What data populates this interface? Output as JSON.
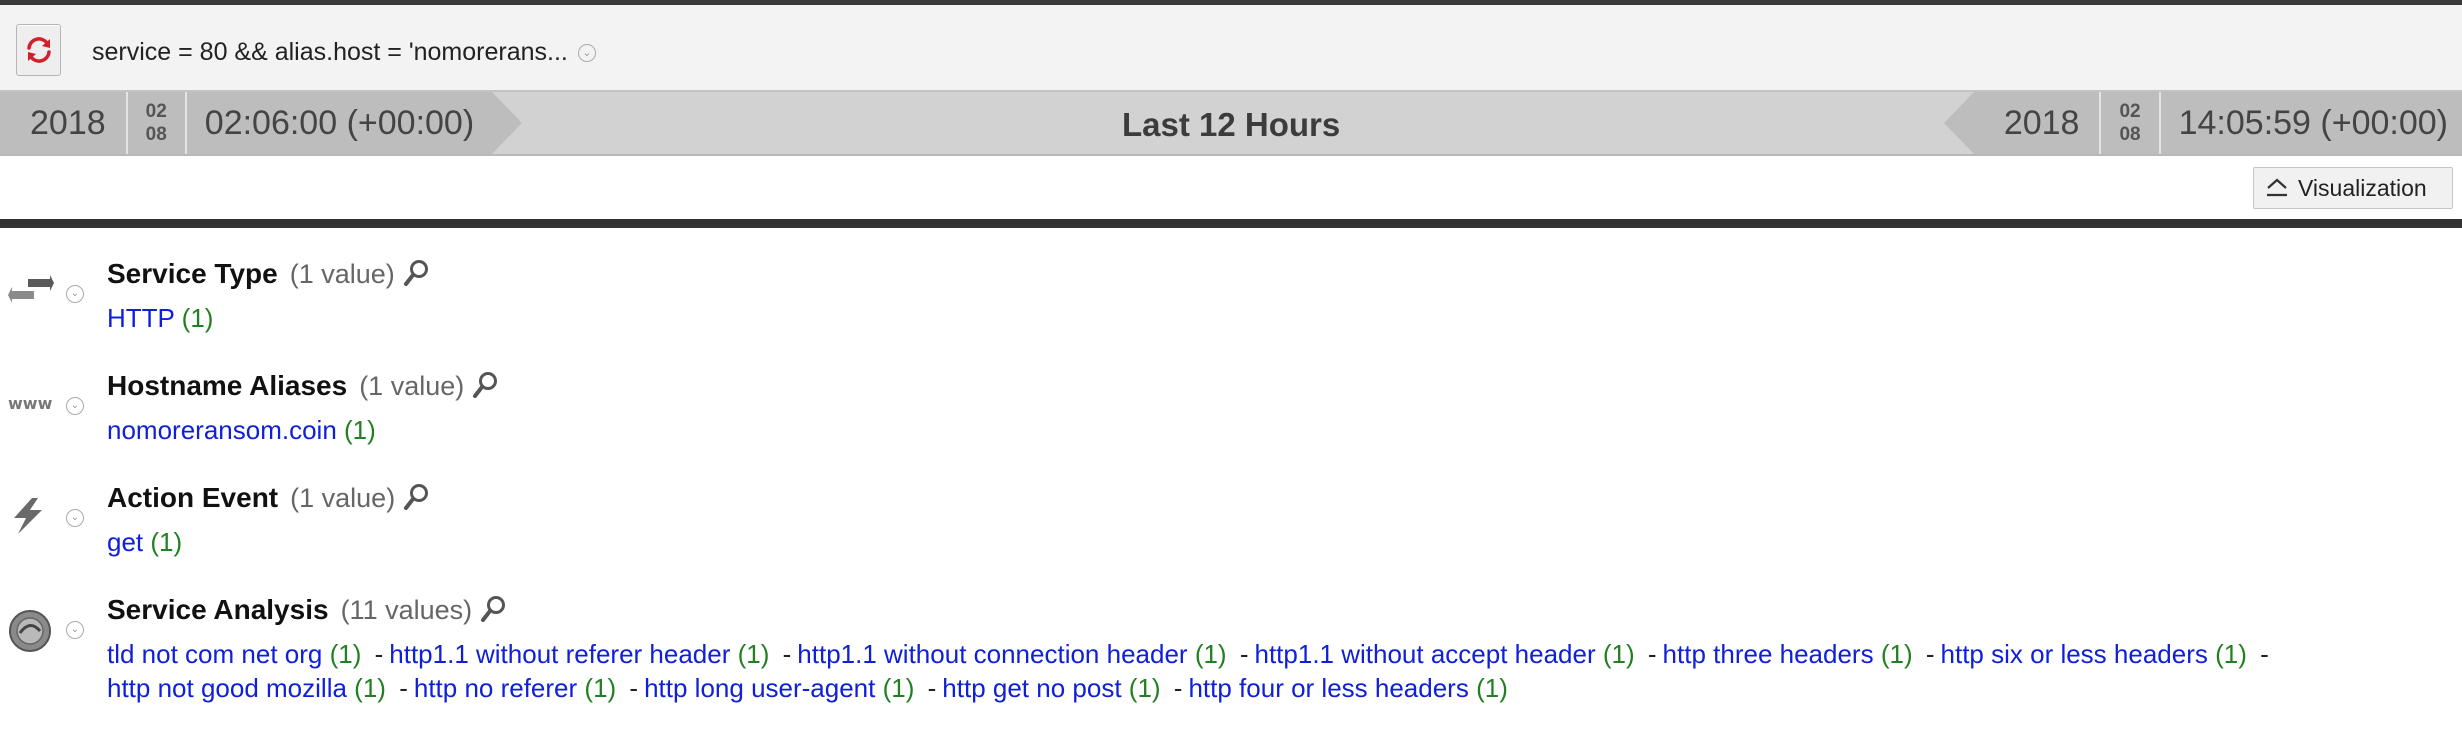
{
  "query": {
    "text": "service = 80 && alias.host = 'nomorerans...",
    "caret": "⌄"
  },
  "time": {
    "start": {
      "year": "2018",
      "month": "02",
      "day": "08",
      "clock": "02:06:00 (+00:00)"
    },
    "end": {
      "year": "2018",
      "month": "02",
      "day": "08",
      "clock": "14:05:59 (+00:00)"
    },
    "range_label": "Last 12 Hours"
  },
  "visualization_label": "Visualization",
  "sections": [
    {
      "key": "service-type",
      "title": "Service Type",
      "count": "(1 value)",
      "icon": "exchange-arrows-icon",
      "values": [
        {
          "label": "HTTP",
          "count": "(1)"
        }
      ]
    },
    {
      "key": "hostname-aliases",
      "title": "Hostname Aliases",
      "count": "(1 value)",
      "icon": "www-icon",
      "values": [
        {
          "label": "nomoreransom.coin",
          "count": "(1)"
        }
      ]
    },
    {
      "key": "action-event",
      "title": "Action Event",
      "count": "(1 value)",
      "icon": "lightning-icon",
      "values": [
        {
          "label": "get",
          "count": "(1)"
        }
      ]
    },
    {
      "key": "service-analysis",
      "title": "Service Analysis",
      "count": "(11 values)",
      "icon": "analysis-disc-icon",
      "values": [
        {
          "label": "tld not com net org",
          "count": "(1)"
        },
        {
          "label": "http1.1 without referer header",
          "count": "(1)"
        },
        {
          "label": "http1.1 without connection header",
          "count": "(1)"
        },
        {
          "label": "http1.1 without accept header",
          "count": "(1)"
        },
        {
          "label": "http three headers",
          "count": "(1)"
        },
        {
          "label": "http six or less headers",
          "count": "(1)"
        },
        {
          "label": "http not good mozilla",
          "count": "(1)"
        },
        {
          "label": "http no referer",
          "count": "(1)"
        },
        {
          "label": "http long user-agent",
          "count": "(1)"
        },
        {
          "label": "http get no post",
          "count": "(1)"
        },
        {
          "label": "http four or less headers",
          "count": "(1)"
        }
      ]
    }
  ],
  "separator": "-",
  "colors": {
    "link": "#1020d8",
    "count": "#228022",
    "divider": "#333333",
    "time_band": "#d2d2d2"
  }
}
